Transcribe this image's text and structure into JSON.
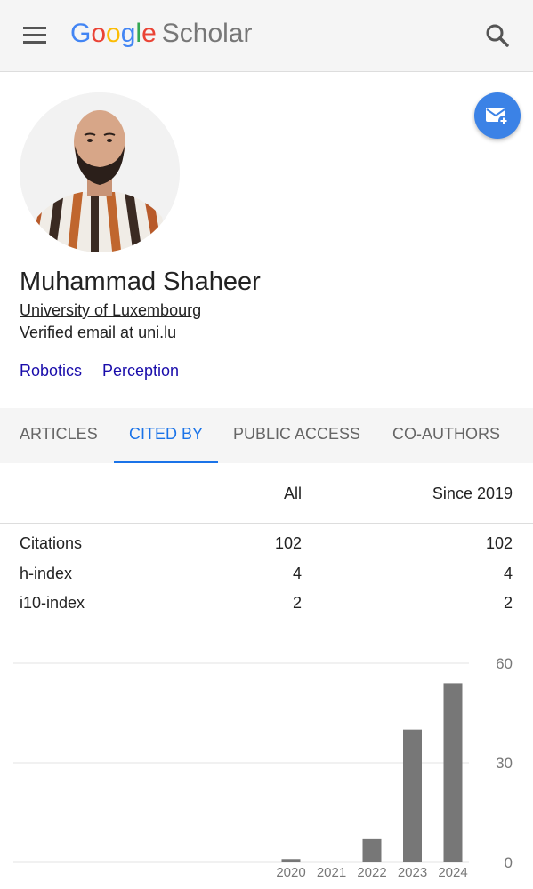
{
  "header": {
    "logo_google": [
      "G",
      "o",
      "o",
      "g",
      "l",
      "e"
    ],
    "logo_scholar": "Scholar",
    "menu_icon": "hamburger-menu-icon",
    "search_icon": "search-icon"
  },
  "profile": {
    "name": "Muhammad Shaheer",
    "affiliation": "University of Luxembourg",
    "email": "Verified email at uni.lu",
    "interests": [
      "Robotics",
      "Perception"
    ],
    "follow_icon": "email-alert-icon"
  },
  "tabs": [
    {
      "label": "ARTICLES",
      "active": false
    },
    {
      "label": "CITED BY",
      "active": true
    },
    {
      "label": "PUBLIC ACCESS",
      "active": false
    },
    {
      "label": "CO-AUTHORS",
      "active": false
    }
  ],
  "stats": {
    "headers": {
      "all": "All",
      "since": "Since 2019"
    },
    "rows": [
      {
        "label": "Citations",
        "all": "102",
        "since": "102"
      },
      {
        "label": "h-index",
        "all": "4",
        "since": "4"
      },
      {
        "label": "i10-index",
        "all": "2",
        "since": "2"
      }
    ]
  },
  "colors": {
    "accent": "#1a73e8",
    "link": "#1a0dab",
    "bar": "#777777",
    "follow_button": "#3b82e6"
  },
  "chart_data": {
    "type": "bar",
    "categories": [
      "2020",
      "2021",
      "2022",
      "2023",
      "2024"
    ],
    "values": [
      1,
      0,
      7,
      40,
      54
    ],
    "ylim": [
      0,
      60
    ],
    "yticks": [
      "0",
      "30",
      "60"
    ],
    "grid": true
  }
}
